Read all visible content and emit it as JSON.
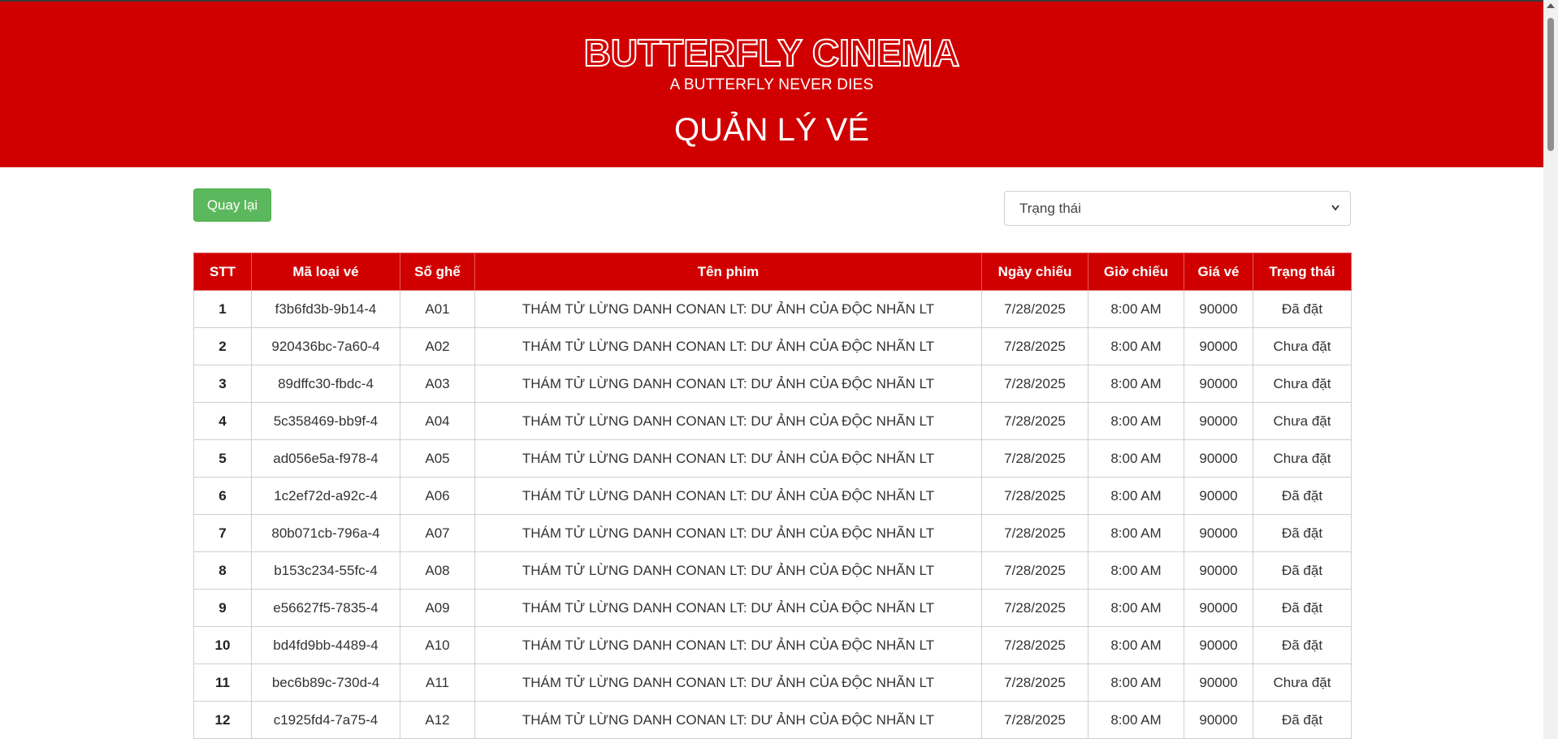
{
  "header": {
    "logo": "BUTTERFLY CINEMA",
    "tagline": "A BUTTERFLY NEVER DIES",
    "title": "QUẢN LÝ VÉ"
  },
  "toolbar": {
    "back_label": "Quay lại",
    "status_filter_selected": "Trạng thái"
  },
  "colors": {
    "brand_red": "#d10000",
    "back_button_green": "#5cb85c"
  },
  "table": {
    "columns": [
      "STT",
      "Mã loại vé",
      "Số ghế",
      "Tên phim",
      "Ngày chiếu",
      "Giờ chiếu",
      "Giá vé",
      "Trạng thái"
    ],
    "rows": [
      [
        "1",
        "f3b6fd3b-9b14-4",
        "A01",
        "THÁM TỬ LỪNG DANH CONAN LT: DƯ ẢNH CỦA ĐỘC NHÃN LT",
        "7/28/2025",
        "8:00 AM",
        "90000",
        "Đã đặt"
      ],
      [
        "2",
        "920436bc-7a60-4",
        "A02",
        "THÁM TỬ LỪNG DANH CONAN LT: DƯ ẢNH CỦA ĐỘC NHÃN LT",
        "7/28/2025",
        "8:00 AM",
        "90000",
        "Chưa đặt"
      ],
      [
        "3",
        "89dffc30-fbdc-4",
        "A03",
        "THÁM TỬ LỪNG DANH CONAN LT: DƯ ẢNH CỦA ĐỘC NHÃN LT",
        "7/28/2025",
        "8:00 AM",
        "90000",
        "Chưa đặt"
      ],
      [
        "4",
        "5c358469-bb9f-4",
        "A04",
        "THÁM TỬ LỪNG DANH CONAN LT: DƯ ẢNH CỦA ĐỘC NHÃN LT",
        "7/28/2025",
        "8:00 AM",
        "90000",
        "Chưa đặt"
      ],
      [
        "5",
        "ad056e5a-f978-4",
        "A05",
        "THÁM TỬ LỪNG DANH CONAN LT: DƯ ẢNH CỦA ĐỘC NHÃN LT",
        "7/28/2025",
        "8:00 AM",
        "90000",
        "Chưa đặt"
      ],
      [
        "6",
        "1c2ef72d-a92c-4",
        "A06",
        "THÁM TỬ LỪNG DANH CONAN LT: DƯ ẢNH CỦA ĐỘC NHÃN LT",
        "7/28/2025",
        "8:00 AM",
        "90000",
        "Đã đặt"
      ],
      [
        "7",
        "80b071cb-796a-4",
        "A07",
        "THÁM TỬ LỪNG DANH CONAN LT: DƯ ẢNH CỦA ĐỘC NHÃN LT",
        "7/28/2025",
        "8:00 AM",
        "90000",
        "Đã đặt"
      ],
      [
        "8",
        "b153c234-55fc-4",
        "A08",
        "THÁM TỬ LỪNG DANH CONAN LT: DƯ ẢNH CỦA ĐỘC NHÃN LT",
        "7/28/2025",
        "8:00 AM",
        "90000",
        "Đã đặt"
      ],
      [
        "9",
        "e56627f5-7835-4",
        "A09",
        "THÁM TỬ LỪNG DANH CONAN LT: DƯ ẢNH CỦA ĐỘC NHÃN LT",
        "7/28/2025",
        "8:00 AM",
        "90000",
        "Đã đặt"
      ],
      [
        "10",
        "bd4fd9bb-4489-4",
        "A10",
        "THÁM TỬ LỪNG DANH CONAN LT: DƯ ẢNH CỦA ĐỘC NHÃN LT",
        "7/28/2025",
        "8:00 AM",
        "90000",
        "Đã đặt"
      ],
      [
        "11",
        "bec6b89c-730d-4",
        "A11",
        "THÁM TỬ LỪNG DANH CONAN LT: DƯ ẢNH CỦA ĐỘC NHÃN LT",
        "7/28/2025",
        "8:00 AM",
        "90000",
        "Chưa đặt"
      ],
      [
        "12",
        "c1925fd4-7a75-4",
        "A12",
        "THÁM TỬ LỪNG DANH CONAN LT: DƯ ẢNH CỦA ĐỘC NHÃN LT",
        "7/28/2025",
        "8:00 AM",
        "90000",
        "Đã đặt"
      ]
    ]
  }
}
